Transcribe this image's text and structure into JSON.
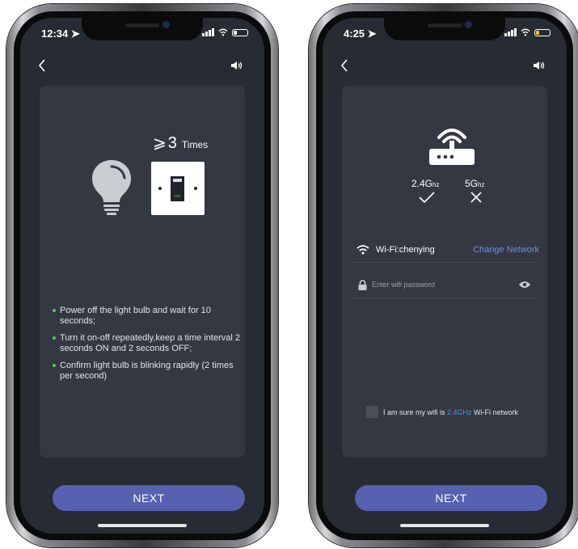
{
  "left": {
    "status": {
      "time": "12:34"
    },
    "times": {
      "symbol": "⩾",
      "count": "3",
      "word": "Times"
    },
    "switch_label": "OFF",
    "steps": [
      "Power off the light bulb and wait for 10 seconds;",
      "Turn it on-off repeatedly,keep a time interval 2 seconds ON and 2 seconds OFF;",
      "Confirm light bulb is blinking rapidly (2 times per second)"
    ],
    "next_label": "NEXT"
  },
  "right": {
    "status": {
      "time": "4:25"
    },
    "bands": [
      {
        "main": "2.4G",
        "unit": "hz"
      },
      {
        "main": "5G",
        "unit": "hz"
      }
    ],
    "wifi": {
      "label": "Wi-Fi:chenying",
      "change_label": "Change Network"
    },
    "password": {
      "placeholder": "Enter wifi password",
      "value": ""
    },
    "confirm": {
      "prefix": "I am sure my wifi is ",
      "highlight": "2.4GHz",
      "suffix": " Wi-Fi network"
    },
    "next_label": "NEXT"
  },
  "colors": {
    "background": "#272b33",
    "card": "#333843",
    "accent_button": "#5661b0",
    "link": "#6f8fe0",
    "bullet": "#59c85b",
    "highlight": "#4f95d8"
  },
  "icons": [
    "back-icon",
    "speaker-icon",
    "bulb-icon",
    "switch-icon",
    "router-icon",
    "check-icon",
    "close-icon",
    "wifi-icon",
    "lock-icon",
    "eye-icon",
    "signal-icon",
    "battery-icon"
  ]
}
